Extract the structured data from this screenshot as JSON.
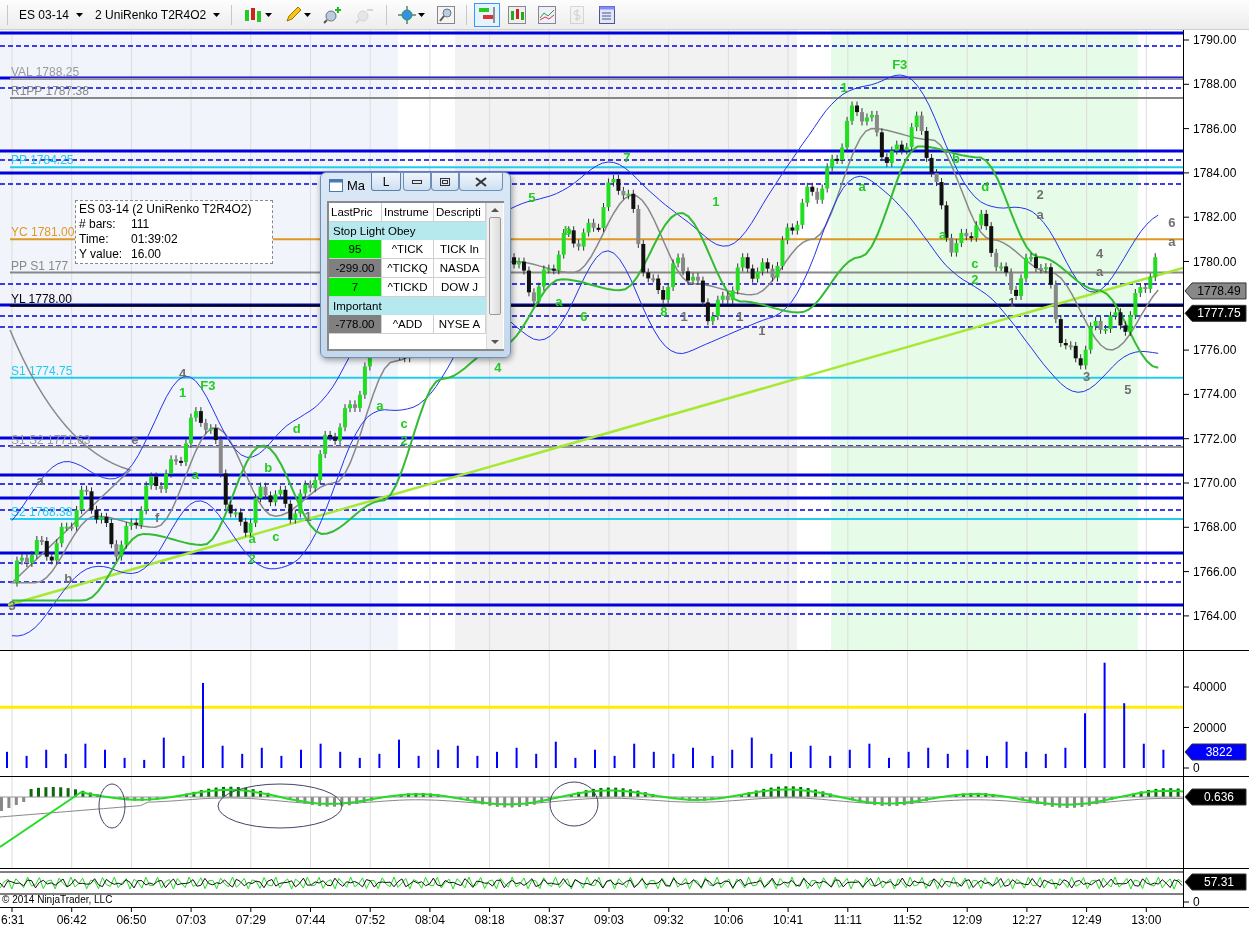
{
  "toolbar": {
    "instrument": "ES 03-14",
    "bar_type": "2 UniRenko T2R4O2",
    "tools": [
      {
        "kind": "candles",
        "menu": true,
        "selected": false,
        "disabled": false
      },
      {
        "kind": "pencil",
        "menu": true,
        "selected": false,
        "disabled": false
      },
      {
        "kind": "zoom-in",
        "menu": false,
        "selected": false,
        "disabled": false
      },
      {
        "kind": "zoom-out",
        "menu": false,
        "selected": false,
        "disabled": true
      },
      {
        "kind": "crosshair",
        "menu": true,
        "selected": false,
        "disabled": false
      },
      {
        "kind": "magnifier",
        "menu": false,
        "selected": false,
        "disabled": false
      },
      {
        "kind": "chart-trader",
        "menu": false,
        "selected": true,
        "disabled": false
      },
      {
        "kind": "bars",
        "menu": false,
        "selected": false,
        "disabled": false
      },
      {
        "kind": "indicators",
        "menu": false,
        "selected": false,
        "disabled": false
      },
      {
        "kind": "strategies",
        "menu": false,
        "selected": false,
        "disabled": true
      },
      {
        "kind": "properties",
        "menu": false,
        "selected": false,
        "disabled": false
      }
    ]
  },
  "price_panel": {
    "levels": [
      {
        "label": "VAL 1788.25",
        "color": "#999999"
      },
      {
        "label": "R1PP 1787.38",
        "color": "#888888"
      },
      {
        "label": "PP 1784.25",
        "color": "#22ccee"
      },
      {
        "label": "YC 1781.00",
        "color": "#dd9922"
      },
      {
        "label": "PP S1 177",
        "color": "#888888"
      },
      {
        "label": "YL 1778.00",
        "color": "#000000"
      },
      {
        "label": "S1 1774.75",
        "color": "#22ccee"
      },
      {
        "label": "S1 S2 1771.63",
        "color": "#999999"
      },
      {
        "label": "S2 1768.38",
        "color": "#22ccee"
      }
    ],
    "wave_labels": [
      {
        "text": "3",
        "color": "#707070"
      },
      {
        "text": "a",
        "color": "#707070"
      },
      {
        "text": "b",
        "color": "#707070"
      },
      {
        "text": "e",
        "color": "#707070"
      },
      {
        "text": "f",
        "color": "#707070"
      },
      {
        "text": "4",
        "color": "#707070"
      },
      {
        "text": "1",
        "color": "#22cc22"
      },
      {
        "text": "F3",
        "color": "#22cc22"
      },
      {
        "text": "a",
        "color": "#22cc22"
      },
      {
        "text": "a",
        "color": "#22cc22"
      },
      {
        "text": "2",
        "color": "#22cc22"
      },
      {
        "text": "b",
        "color": "#22cc22"
      },
      {
        "text": "c",
        "color": "#22cc22"
      },
      {
        "text": "d",
        "color": "#22cc22"
      },
      {
        "text": "1",
        "color": "#707070"
      },
      {
        "text": "a",
        "color": "#22cc22"
      },
      {
        "text": "c",
        "color": "#22cc22"
      },
      {
        "text": "2",
        "color": "#22cc22"
      },
      {
        "text": "4",
        "color": "#22cc22"
      },
      {
        "text": "5",
        "color": "#22cc22"
      },
      {
        "text": "b",
        "color": "#22cc22"
      },
      {
        "text": "a",
        "color": "#22cc22"
      },
      {
        "text": "6",
        "color": "#22cc22"
      },
      {
        "text": "7",
        "color": "#22cc22"
      },
      {
        "text": "8",
        "color": "#22cc22"
      },
      {
        "text": "1",
        "color": "#707070"
      },
      {
        "text": "1",
        "color": "#22cc22"
      },
      {
        "text": "1",
        "color": "#707070"
      },
      {
        "text": "1",
        "color": "#707070"
      },
      {
        "text": "1",
        "color": "#22cc22"
      },
      {
        "text": "F3",
        "color": "#22cc22"
      },
      {
        "text": "a",
        "color": "#22cc22"
      },
      {
        "text": "a",
        "color": "#22cc22"
      },
      {
        "text": "b",
        "color": "#22cc22"
      },
      {
        "text": "d",
        "color": "#22cc22"
      },
      {
        "text": "c",
        "color": "#22cc22"
      },
      {
        "text": "2",
        "color": "#22cc22"
      },
      {
        "text": "1",
        "color": "#555555"
      },
      {
        "text": "2",
        "color": "#707070"
      },
      {
        "text": "a",
        "color": "#707070"
      },
      {
        "text": "4",
        "color": "#707070"
      },
      {
        "text": "a",
        "color": "#707070"
      },
      {
        "text": "3",
        "color": "#707070"
      },
      {
        "text": "5",
        "color": "#707070"
      },
      {
        "text": "6",
        "color": "#707070"
      },
      {
        "text": "a",
        "color": "#707070"
      }
    ],
    "axis_labels": [
      "1790.00",
      "1788.00",
      "1786.00",
      "1784.00",
      "1782.00",
      "1780.00",
      "1776.00",
      "1774.00",
      "1772.00",
      "1770.00",
      "1768.00",
      "1766.00",
      "1764.00"
    ],
    "price_tags": [
      {
        "text": "1778.49",
        "color": "#888888"
      },
      {
        "text": "1777.75",
        "color": "#000000"
      }
    ]
  },
  "volume_panel": {
    "axis_labels": [
      "40000",
      "20000",
      "0"
    ],
    "tag": "3822"
  },
  "oscillator_panel": {
    "tag": "0.636"
  },
  "bottom_panel": {
    "tag": "57.31",
    "axis_label": "0",
    "copyright": "© 2014 NinjaTrader, LLC"
  },
  "time_axis": [
    "6:31",
    "06:42",
    "06:50",
    "07:03",
    "07:29",
    "07:44",
    "07:52",
    "08:04",
    "08:18",
    "08:37",
    "09:03",
    "09:32",
    "10:06",
    "10:41",
    "11:11",
    "11:52",
    "12:09",
    "12:27",
    "12:49",
    "13:00"
  ],
  "tooltip": {
    "title": "ES 03-14 (2 UniRenko T2R4O2)",
    "rows": [
      {
        "label": "# bars:",
        "value": "111"
      },
      {
        "label": "Time:",
        "value": "01:39:02"
      },
      {
        "label": "Y value:",
        "value": "16.00"
      }
    ]
  },
  "analyzer": {
    "title": "Ma",
    "link_button": "L",
    "columns": [
      "LastPric",
      "Instrume",
      "Descripti"
    ],
    "groups": [
      {
        "name": "Stop Light Obey",
        "rows": [
          {
            "last": "95",
            "color": "#00ee00",
            "instrument": "^TICK",
            "description": "TICK In"
          },
          {
            "last": "-299.00",
            "color": "#808080",
            "instrument": "^TICKQ",
            "description": "NASDA"
          },
          {
            "last": "7",
            "color": "#00ee00",
            "instrument": "^TICKD",
            "description": "DOW J"
          }
        ]
      },
      {
        "name": "Important",
        "rows": [
          {
            "last": "-778.00",
            "color": "#808080",
            "instrument": "^ADD",
            "description": "NYSE A"
          }
        ]
      }
    ]
  }
}
